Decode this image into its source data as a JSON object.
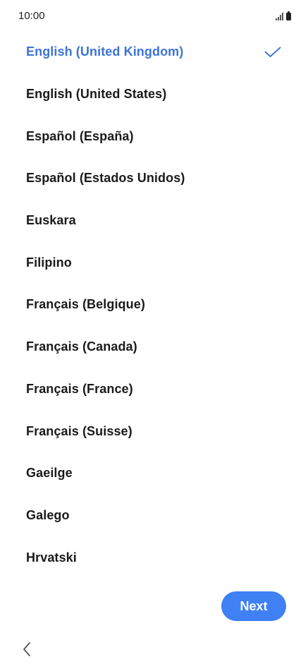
{
  "status_bar": {
    "time": "10:00",
    "icons": [
      "signal-icon",
      "battery-icon"
    ]
  },
  "languages": [
    {
      "label": "English (United Kingdom)",
      "selected": true
    },
    {
      "label": "English (United States)",
      "selected": false
    },
    {
      "label": "Español (España)",
      "selected": false
    },
    {
      "label": "Español (Estados Unidos)",
      "selected": false
    },
    {
      "label": "Euskara",
      "selected": false
    },
    {
      "label": "Filipino",
      "selected": false
    },
    {
      "label": "Français (Belgique)",
      "selected": false
    },
    {
      "label": "Français (Canada)",
      "selected": false
    },
    {
      "label": "Français (France)",
      "selected": false
    },
    {
      "label": "Français (Suisse)",
      "selected": false
    },
    {
      "label": "Gaeilge",
      "selected": false
    },
    {
      "label": "Galego",
      "selected": false
    },
    {
      "label": "Hrvatski",
      "selected": false
    }
  ],
  "actions": {
    "next_label": "Next"
  },
  "navigation": {
    "back_icon": "chevron-left-icon"
  },
  "colors": {
    "accent": "#3e73d8",
    "button": "#3f80f5",
    "text": "#1a1a1a",
    "background": "#ffffff"
  }
}
